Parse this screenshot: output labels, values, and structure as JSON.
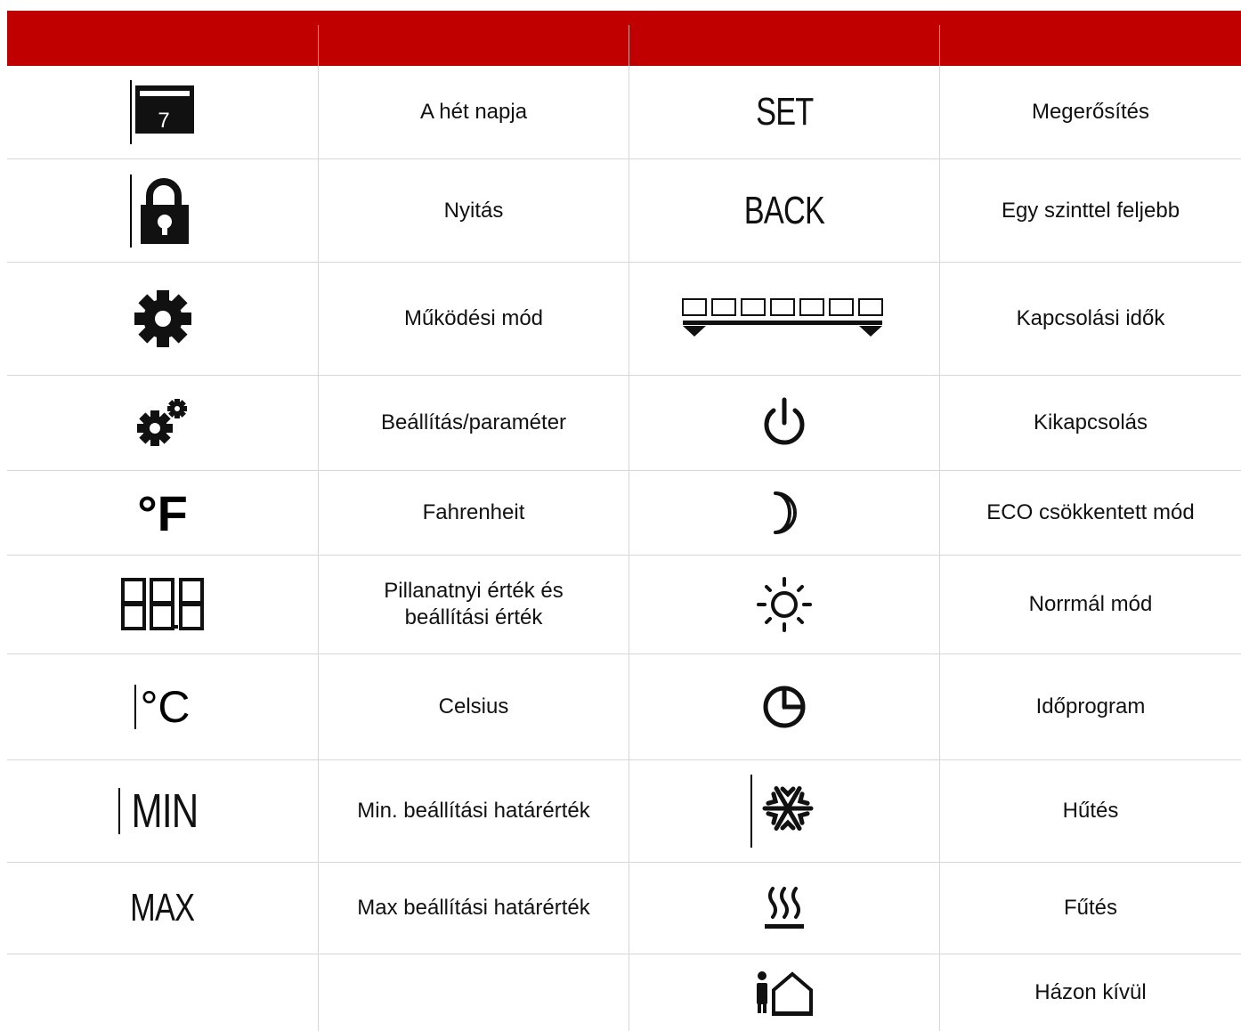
{
  "table": {
    "header": [
      "",
      "",
      "",
      ""
    ],
    "rows": [
      {
        "left_icon": "calendar-day-icon",
        "left_calendar_digit": "7",
        "left_label": "A hét napja",
        "right_icon": "set-text-icon",
        "right_icon_text": "SET",
        "right_label": "Megerősítés"
      },
      {
        "left_icon": "padlock-icon",
        "left_label": "Nyitás",
        "right_icon": "back-text-icon",
        "right_icon_text": "BACK",
        "right_label": "Egy szinttel feljebb"
      },
      {
        "left_icon": "gear-icon",
        "left_label": "Működési mód",
        "right_icon": "switching-times-bar-icon",
        "right_label": "Kapcsolási idők"
      },
      {
        "left_icon": "gears-icon",
        "left_label": "Beállítás/paraméter",
        "right_icon": "power-icon",
        "right_label": "Kikapcsolás"
      },
      {
        "left_icon": "fahrenheit-icon",
        "left_icon_text": "°F",
        "left_label": "Fahrenheit",
        "right_icon": "moon-icon",
        "right_label": "ECO csökkentett mód"
      },
      {
        "left_icon": "seven-segment-display-icon",
        "left_label": "Pillanatnyi érték és beállítási érték",
        "right_icon": "sun-icon",
        "right_label": "Norrmál mód"
      },
      {
        "left_icon": "celsius-icon",
        "left_icon_text": "°C",
        "left_label": "Celsius",
        "right_icon": "clock-program-icon",
        "right_label": "Időprogram"
      },
      {
        "left_icon": "min-text-icon",
        "left_icon_text": "MIN",
        "left_label": "Min. beállítási határérték",
        "right_icon": "snowflake-icon",
        "right_label": "Hűtés"
      },
      {
        "left_icon": "max-text-icon",
        "left_icon_text": "MAX",
        "left_label": "Max beállítási határérték",
        "right_icon": "heating-icon",
        "right_label": "Fűtés"
      },
      {
        "left_icon": "",
        "left_label": "",
        "right_icon": "away-from-home-icon",
        "right_label": "Házon kívül"
      }
    ]
  },
  "colors": {
    "header": "#c00000",
    "grid": "#d7d7d7",
    "text": "#111111"
  }
}
